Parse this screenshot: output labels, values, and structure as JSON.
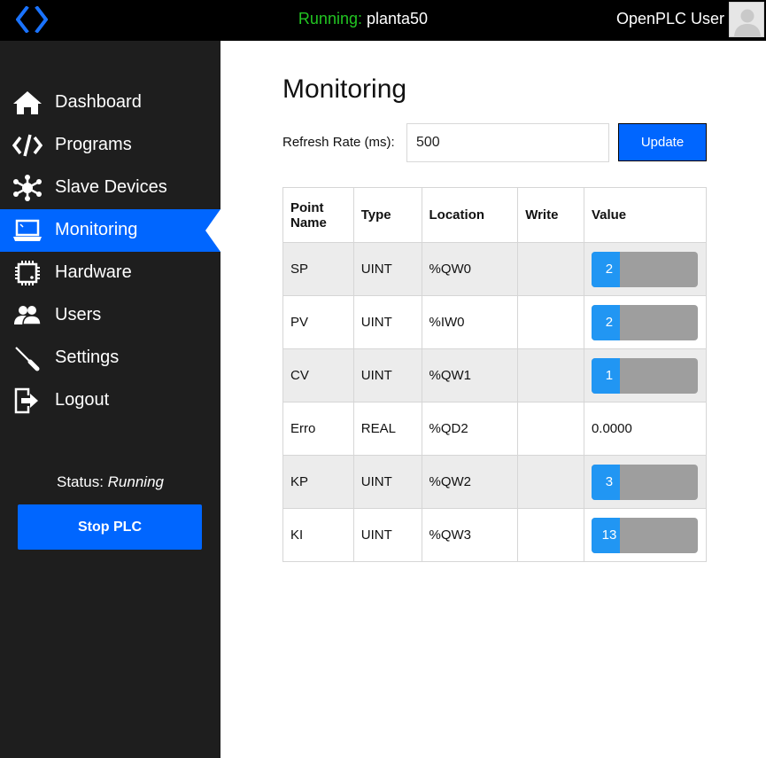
{
  "topbar": {
    "logo_icon": "code-brackets-icon",
    "running_label": "Running:",
    "program_name": "planta50",
    "user_name": "OpenPLC User",
    "avatar_icon": "user-avatar-icon"
  },
  "sidebar": {
    "items": [
      {
        "label": "Dashboard",
        "icon": "home-icon"
      },
      {
        "label": "Programs",
        "icon": "code-icon"
      },
      {
        "label": "Slave Devices",
        "icon": "network-icon"
      },
      {
        "label": "Monitoring",
        "icon": "monitor-icon",
        "active": true
      },
      {
        "label": "Hardware",
        "icon": "chip-icon"
      },
      {
        "label": "Users",
        "icon": "users-icon"
      },
      {
        "label": "Settings",
        "icon": "screwdriver-icon"
      },
      {
        "label": "Logout",
        "icon": "logout-icon"
      }
    ],
    "status_label": "Status:",
    "status_value": "Running",
    "stop_button": "Stop PLC"
  },
  "main": {
    "title": "Monitoring",
    "refresh_label": "Refresh Rate (ms):",
    "refresh_value": "500",
    "update_button": "Update",
    "table": {
      "headers": [
        "Point Name",
        "Type",
        "Location",
        "Write",
        "Value"
      ],
      "rows": [
        {
          "name": "SP",
          "type": "UINT",
          "location": "%QW0",
          "write": "",
          "value": "2",
          "gauge": true
        },
        {
          "name": "PV",
          "type": "UINT",
          "location": "%IW0",
          "write": "",
          "value": "2",
          "gauge": true
        },
        {
          "name": "CV",
          "type": "UINT",
          "location": "%QW1",
          "write": "",
          "value": "1",
          "gauge": true
        },
        {
          "name": "Erro",
          "type": "REAL",
          "location": "%QD2",
          "write": "",
          "value": "0.0000",
          "gauge": false
        },
        {
          "name": "KP",
          "type": "UINT",
          "location": "%QW2",
          "write": "",
          "value": "3",
          "gauge": true
        },
        {
          "name": "KI",
          "type": "UINT",
          "location": "%QW3",
          "write": "",
          "value": "13",
          "gauge": true
        }
      ]
    }
  },
  "colors": {
    "accent": "#0066ff",
    "running": "#22c522",
    "sidebar_bg": "#1e1e1e",
    "gauge_fill": "#2196f3",
    "gauge_track": "#9e9e9e"
  }
}
